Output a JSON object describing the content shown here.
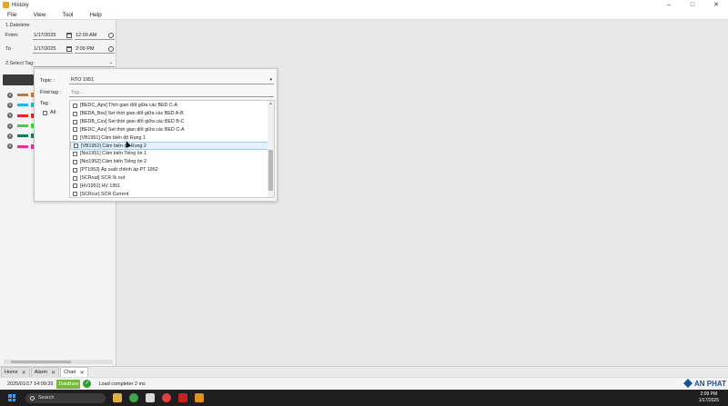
{
  "window": {
    "title": "History"
  },
  "menu": [
    "File",
    "View",
    "Tool",
    "Help"
  ],
  "datetime": {
    "section": "1.Datetime",
    "from_label": "From:",
    "from_date": "1/17/2025",
    "from_time": "12:00 AM",
    "to_label": "To",
    "to_date": "1/17/2025",
    "to_time": "2:09 PM"
  },
  "select_tag": {
    "section": "2.Select Tag:"
  },
  "tag_colors": [
    "#c87533",
    "#23b3e6",
    "#e02828",
    "#3bd43b",
    "#147a5c",
    "#e0338f"
  ],
  "popup": {
    "topic_label": "Topic :",
    "topic_value": "RTO 1951",
    "find_label": "Find tag :",
    "find_placeholder": "Tag...",
    "tag_label": "Tag :",
    "all_label": "All",
    "tags": [
      "[BEDC_Apv] Thời gian đốt giữa các BED C-A",
      "[BEDA_Bsv] Set thời gian đốt giữa các BED A-B",
      "[BEDB_Csv] Set thời gian đốt giữa các BED B-C",
      "[BEDC_Asv] Set thời gian đốt giữa các BED C-A",
      "[VB1951] Cảm biến độ Rung 1",
      "[VB1952] Cảm biến độ Rung 2",
      "[Noi1951] Cảm biến Tiếng ồn 1",
      "[Noi1952] Cảm biến Tiếng ồn 2",
      "[PT1952] Áp suất chênh áp PT 1952",
      "[SCRout] SCR % out",
      "[HV1951] HV 1951",
      "[SCRcur] SCR Current"
    ]
  },
  "tabs": [
    "Home",
    "Alarm",
    "Chart"
  ],
  "status": {
    "timestamp": "2025/01/17 14:09:29",
    "badge": "DataBase",
    "message": "Load completer 2 ms"
  },
  "logo_text": "AN PHAT",
  "taskbar": {
    "search_placeholder": "Search",
    "time": "2:09 PM",
    "date": "1/17/2025"
  }
}
